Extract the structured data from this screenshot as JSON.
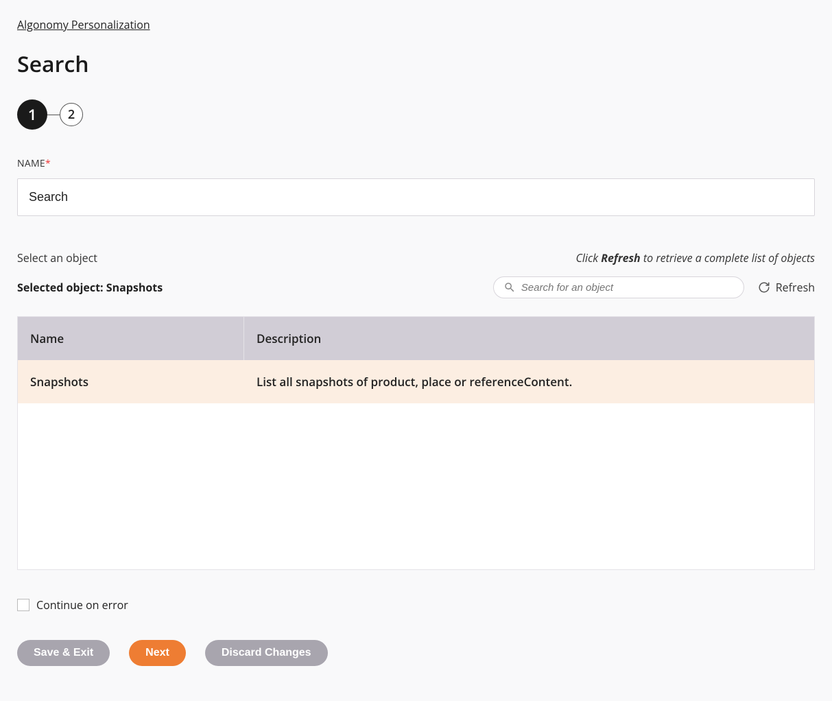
{
  "breadcrumb": "Algonomy Personalization",
  "title": "Search",
  "stepper": {
    "step1": "1",
    "step2": "2"
  },
  "name_field": {
    "label": "NAME",
    "value": "Search"
  },
  "select_section": {
    "label": "Select an object",
    "hint_prefix": "Click ",
    "hint_bold": "Refresh",
    "hint_suffix": " to retrieve a complete list of objects",
    "selected_prefix": "Selected object: ",
    "selected_value": "Snapshots",
    "search_placeholder": "Search for an object",
    "refresh_label": "Refresh"
  },
  "table": {
    "columns": {
      "name": "Name",
      "desc": "Description"
    },
    "rows": [
      {
        "name": "Snapshots",
        "desc": "List all snapshots of product, place or referenceContent."
      }
    ]
  },
  "continue_on_error": "Continue on error",
  "buttons": {
    "save_exit": "Save & Exit",
    "next": "Next",
    "discard": "Discard Changes"
  }
}
